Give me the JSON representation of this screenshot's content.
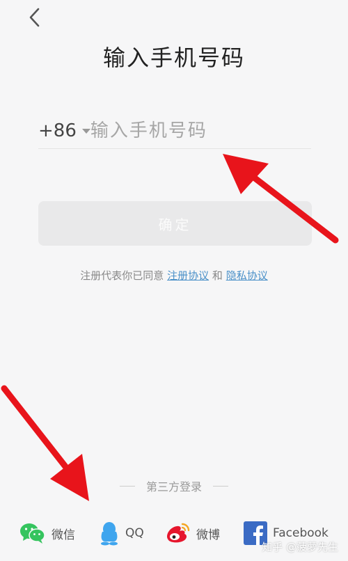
{
  "header": {
    "title": "输入手机号码"
  },
  "phone": {
    "country_code": "+86",
    "placeholder": "输入手机号码",
    "value": ""
  },
  "confirm": {
    "label": "确定"
  },
  "agreement": {
    "prefix": "注册代表你已同意",
    "terms_link": "注册协议",
    "conjunction": "和",
    "privacy_link": "隐私协议"
  },
  "third_party": {
    "title": "第三方登录",
    "providers": [
      {
        "label": "微信",
        "icon": "wechat-icon",
        "color": "#35c45e"
      },
      {
        "label": "QQ",
        "icon": "qq-icon",
        "color": "#3fa5ee"
      },
      {
        "label": "微博",
        "icon": "weibo-icon",
        "color": "#e6162d"
      },
      {
        "label": "Facebook",
        "icon": "facebook-icon",
        "color": "#3b6bc4"
      }
    ]
  },
  "watermark": "知乎 @菠萝先生",
  "colors": {
    "annotation_arrow": "#e8141b",
    "link": "#4a90c8"
  }
}
